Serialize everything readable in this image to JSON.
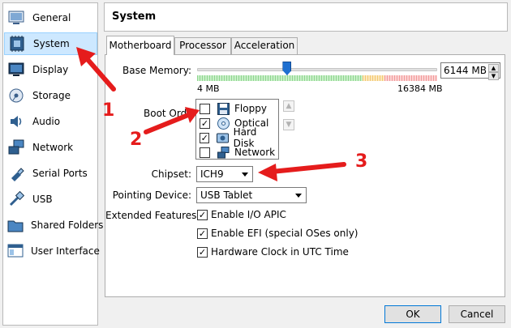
{
  "sidebar": {
    "items": [
      {
        "label": "General",
        "icon": "general-icon",
        "selected": false
      },
      {
        "label": "System",
        "icon": "system-icon",
        "selected": true
      },
      {
        "label": "Display",
        "icon": "display-icon",
        "selected": false
      },
      {
        "label": "Storage",
        "icon": "storage-icon",
        "selected": false
      },
      {
        "label": "Audio",
        "icon": "audio-icon",
        "selected": false
      },
      {
        "label": "Network",
        "icon": "network-icon",
        "selected": false
      },
      {
        "label": "Serial Ports",
        "icon": "serial-ports-icon",
        "selected": false
      },
      {
        "label": "USB",
        "icon": "usb-icon",
        "selected": false
      },
      {
        "label": "Shared Folders",
        "icon": "shared-folders-icon",
        "selected": false
      },
      {
        "label": "User Interface",
        "icon": "user-interface-icon",
        "selected": false
      }
    ]
  },
  "header": {
    "title": "System"
  },
  "tabs": [
    {
      "label": "Motherboard",
      "active": true
    },
    {
      "label": "Processor",
      "active": false
    },
    {
      "label": "Acceleration",
      "active": false
    }
  ],
  "motherboard": {
    "base_memory": {
      "label": "Base Memory:",
      "value": "6144 MB",
      "min_label": "4 MB",
      "max_label": "16384 MB",
      "min_mb": 4,
      "max_mb": 16384,
      "current_mb": 6144
    },
    "boot_order": {
      "label": "Boot Orde",
      "items": [
        {
          "label": "Floppy",
          "checked": false,
          "icon": "floppy-icon"
        },
        {
          "label": "Optical",
          "checked": true,
          "icon": "optical-disc-icon"
        },
        {
          "label": "Hard Disk",
          "checked": true,
          "icon": "hard-disk-icon"
        },
        {
          "label": "Network",
          "checked": false,
          "icon": "network-icon"
        }
      ]
    },
    "chipset": {
      "label": "Chipset:",
      "value": "ICH9"
    },
    "pointing_device": {
      "label": "Pointing Device:",
      "value": "USB Tablet"
    },
    "extended_features": {
      "label": "Extended Features:",
      "items": [
        {
          "label": "Enable I/O APIC",
          "checked": true
        },
        {
          "label": "Enable EFI (special OSes only)",
          "checked": true
        },
        {
          "label": "Hardware Clock in UTC Time",
          "checked": true
        }
      ]
    }
  },
  "buttons": {
    "ok": "OK",
    "cancel": "Cancel"
  },
  "annotations": {
    "callout_1": "1",
    "callout_2": "2",
    "callout_3": "3",
    "color": "#e51c1c"
  },
  "colors": {
    "selection_bg": "#cde8ff",
    "accent": "#1e6fd0"
  }
}
